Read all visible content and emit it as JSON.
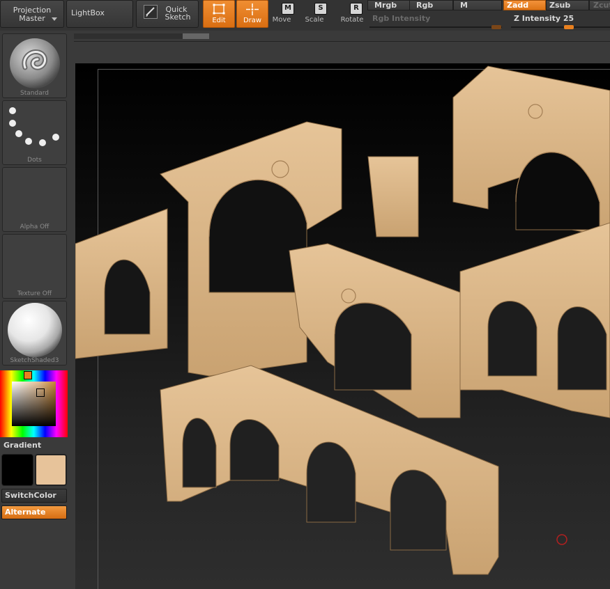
{
  "toolbar": {
    "projection_master": {
      "line1": "Projection",
      "line2": "Master"
    },
    "lightbox": "LightBox",
    "quick_sketch": {
      "line1": "Quick",
      "line2": "Sketch"
    },
    "tools": [
      {
        "label": "Edit",
        "icon": "edit-icon",
        "active": true
      },
      {
        "label": "Draw",
        "icon": "draw-icon",
        "active": true
      },
      {
        "label": "Move",
        "icon": "move-icon",
        "key": "M",
        "active": false
      },
      {
        "label": "Scale",
        "icon": "scale-icon",
        "key": "S",
        "active": false
      },
      {
        "label": "Rotate",
        "icon": "rotate-icon",
        "key": "R",
        "active": false
      }
    ],
    "color_modes": {
      "mrgb": "Mrgb",
      "rgb": "Rgb",
      "m": "M"
    },
    "depth_modes": {
      "zadd": "Zadd",
      "zsub": "Zsub",
      "zcut": "Zcut",
      "active": "Zadd"
    },
    "rgb_intensity": {
      "label": "Rgb Intensity"
    },
    "z_intensity": {
      "label": "Z Intensity",
      "value": "25"
    }
  },
  "tray": {
    "brush": {
      "caption": "Standard",
      "icon": "standard-brush-icon"
    },
    "stroke": {
      "caption": "Dots",
      "icon": "dots-stroke-icon"
    },
    "alpha": {
      "caption": "Alpha Off"
    },
    "texture": {
      "caption": "Texture Off"
    },
    "material": {
      "caption": "SketchShaded3",
      "icon": "material-sphere-icon"
    },
    "gradient_label": "Gradient",
    "switch_color": "SwitchColor",
    "alternate": "Alternate"
  },
  "colors": {
    "accent": "#e8801f",
    "main_color": "#e7c39a",
    "secondary_color": "#000000",
    "model_color": "#d9b484"
  },
  "canvas": {
    "model": "gothic-arcade-model"
  }
}
